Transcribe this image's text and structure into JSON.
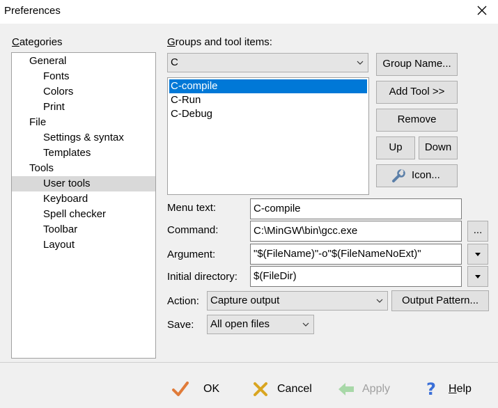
{
  "window": {
    "title": "Preferences"
  },
  "categories": {
    "label": "Categories",
    "items": [
      {
        "label": "General",
        "level": 1,
        "selected": false
      },
      {
        "label": "Fonts",
        "level": 2,
        "selected": false
      },
      {
        "label": "Colors",
        "level": 2,
        "selected": false
      },
      {
        "label": "Print",
        "level": 2,
        "selected": false
      },
      {
        "label": "File",
        "level": 1,
        "selected": false
      },
      {
        "label": "Settings & syntax",
        "level": 2,
        "selected": false
      },
      {
        "label": "Templates",
        "level": 2,
        "selected": false
      },
      {
        "label": "Tools",
        "level": 1,
        "selected": false
      },
      {
        "label": "User tools",
        "level": 2,
        "selected": true
      },
      {
        "label": "Keyboard",
        "level": 2,
        "selected": false
      },
      {
        "label": "Spell checker",
        "level": 2,
        "selected": false
      },
      {
        "label": "Toolbar",
        "level": 2,
        "selected": false
      },
      {
        "label": "Layout",
        "level": 2,
        "selected": false
      }
    ]
  },
  "groups": {
    "label": "Groups and tool items:",
    "group_selected": "C",
    "tools": [
      {
        "label": "C-compile",
        "selected": true
      },
      {
        "label": "C-Run",
        "selected": false
      },
      {
        "label": "C-Debug",
        "selected": false
      }
    ],
    "buttons": {
      "group_name": "Group Name...",
      "add_tool": "Add Tool >>",
      "remove": "Remove",
      "up": "Up",
      "down": "Down",
      "icon": "Icon..."
    }
  },
  "fields": {
    "menu_text_label": "Menu text:",
    "menu_text_value": "C-compile",
    "command_label": "Command:",
    "command_value": "C:\\MinGW\\bin\\gcc.exe",
    "browse": "...",
    "argument_label": "Argument:",
    "argument_value": "\"$(FileName)\"-o\"$(FileNameNoExt)\"",
    "initial_dir_label": "Initial directory:",
    "initial_dir_value": "$(FileDir)",
    "action_label": "Action:",
    "action_value": "Capture output",
    "output_pattern": "Output Pattern...",
    "save_label": "Save:",
    "save_value": "All open files"
  },
  "footer": {
    "ok": "OK",
    "cancel": "Cancel",
    "apply": "Apply",
    "help": "Help"
  },
  "colors": {
    "selection": "#0078d7",
    "selection_inactive": "#d9d9d9",
    "ok_check": "#e07b39",
    "cancel_x": "#d9a520",
    "help_icon": "#3a6fd8",
    "apply_arrow_disabled": "#a8d8a8"
  }
}
